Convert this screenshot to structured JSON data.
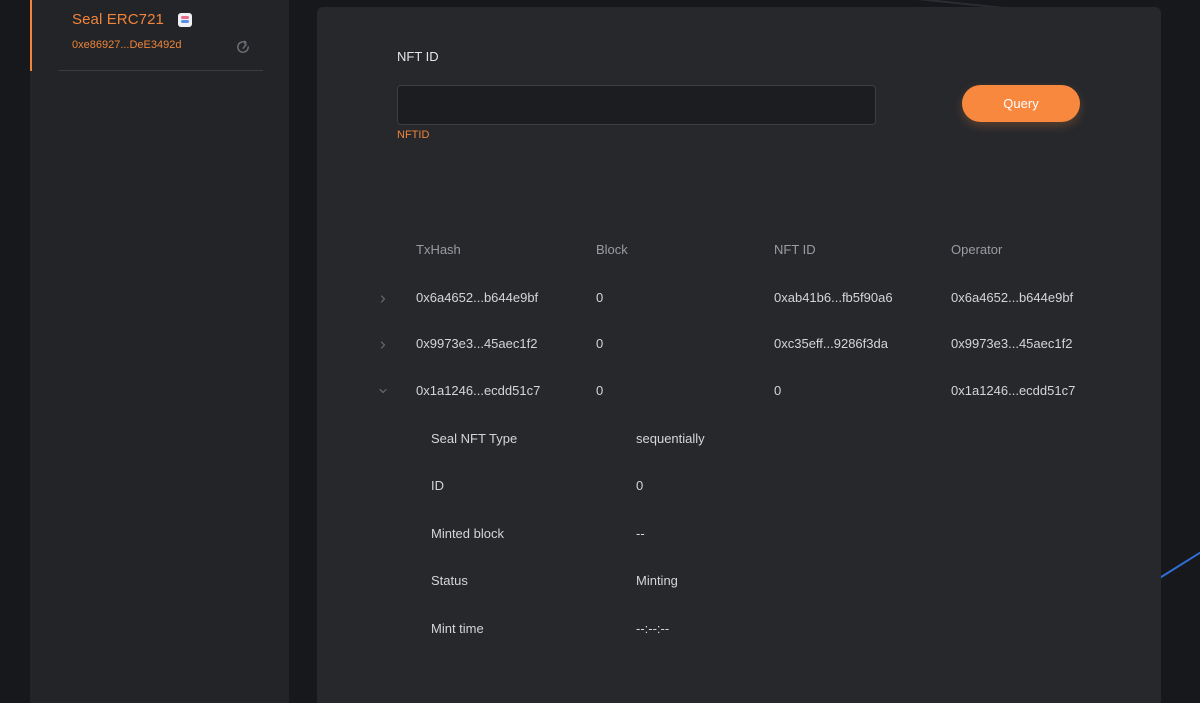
{
  "sidebar": {
    "contract": {
      "name": "Seal ERC721",
      "address": "0xe86927...DeE3492d"
    }
  },
  "form": {
    "label": "NFT ID",
    "value": "",
    "placeholder": "",
    "hint": "NFTID",
    "query_label": "Query"
  },
  "table": {
    "headers": [
      "TxHash",
      "Block",
      "NFT ID",
      "Operator"
    ],
    "rows": [
      {
        "txhash": "0x6a4652...b644e9bf",
        "block": "0",
        "nft_id": "0xab41b6...fb5f90a6",
        "operator": "0x6a4652...b644e9bf",
        "expanded": false
      },
      {
        "txhash": "0x9973e3...45aec1f2",
        "block": "0",
        "nft_id": "0xc35eff...9286f3da",
        "operator": "0x9973e3...45aec1f2",
        "expanded": false
      },
      {
        "txhash": "0x1a1246...ecdd51c7",
        "block": "0",
        "nft_id": "0",
        "operator": "0x1a1246...ecdd51c7",
        "expanded": true
      }
    ]
  },
  "details": [
    {
      "label": "Seal NFT Type",
      "value": "sequentially"
    },
    {
      "label": "ID",
      "value": "0"
    },
    {
      "label": "Minted block",
      "value": "--"
    },
    {
      "label": "Status",
      "value": "Minting"
    },
    {
      "label": "Mint time",
      "value": "--:--:--"
    }
  ],
  "colors": {
    "accent": "#f7883e",
    "panel": "#26282c",
    "sidebar": "#222428",
    "background": "#17181b"
  }
}
